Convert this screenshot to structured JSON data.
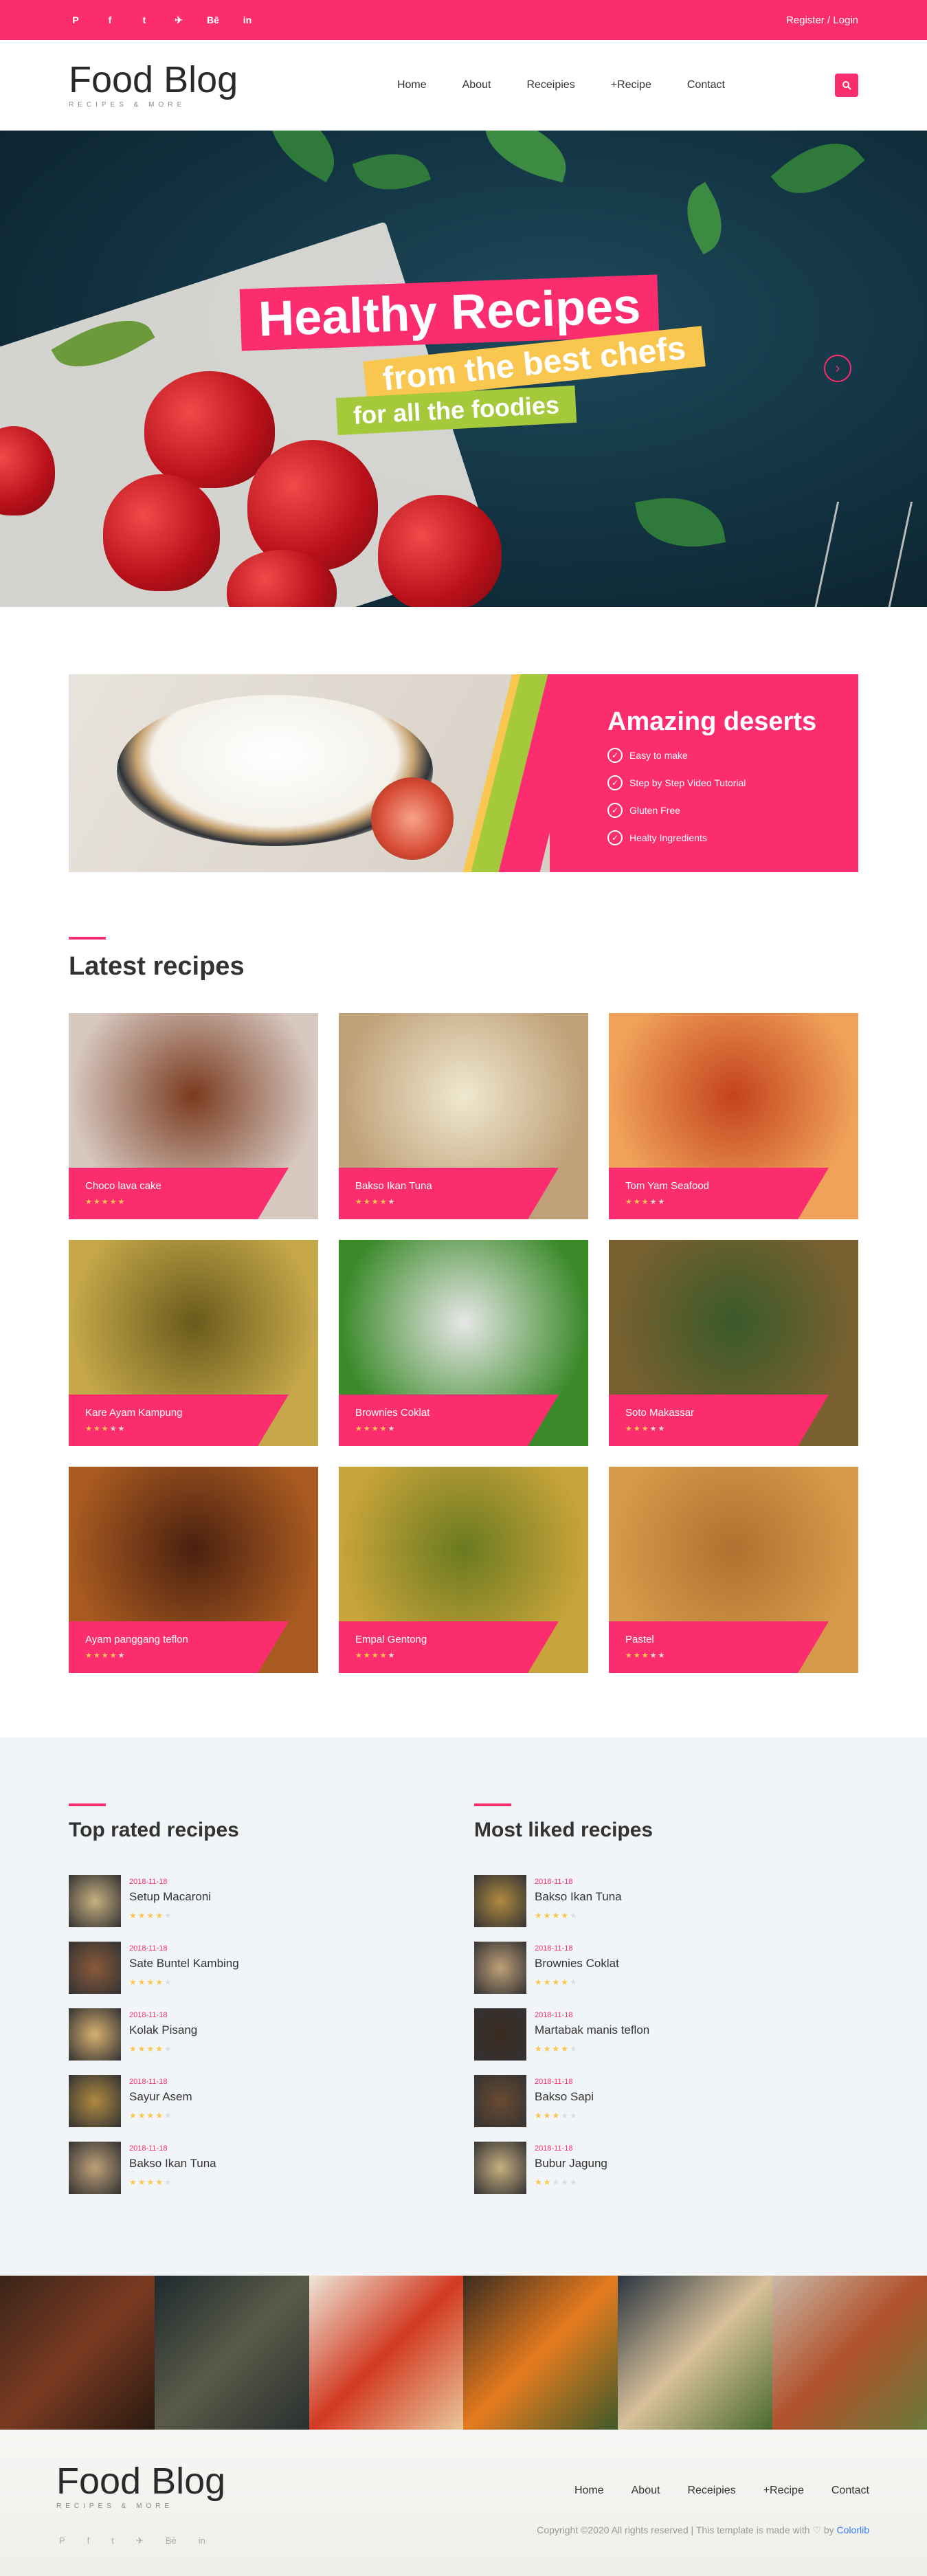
{
  "topbar": {
    "social": [
      "P",
      "f",
      "t",
      "✈",
      "Bē",
      "in"
    ],
    "login": "Register / Login"
  },
  "brand": {
    "name": "Food Blog",
    "tagline": "RECIPES & MORE"
  },
  "nav": [
    "Home",
    "About",
    "Receipies",
    "+Recipe",
    "Contact"
  ],
  "hero": {
    "line1": "Healthy Recipes",
    "line2": "from the best chefs",
    "line3": "for all the foodies"
  },
  "promo": {
    "title": "Amazing deserts",
    "items": [
      "Easy to make",
      "Step by Step Video Tutorial",
      "Gluten Free",
      "Healty Ingredients"
    ]
  },
  "latest": {
    "title": "Latest recipes",
    "items": [
      {
        "title": "Choco lava cake",
        "stars": 5,
        "c1": "#d7c8c0",
        "c2": "#7a3a1f"
      },
      {
        "title": "Bakso Ikan Tuna",
        "stars": 4,
        "c1": "#bfa078",
        "c2": "#efe8cf"
      },
      {
        "title": "Tom Yam Seafood",
        "stars": 3,
        "c1": "#f0a25a",
        "c2": "#c4421d"
      },
      {
        "title": "Kare Ayam Kampung",
        "stars": 3,
        "c1": "#c6a84a",
        "c2": "#6a5a1c"
      },
      {
        "title": "Brownies Coklat",
        "stars": 4,
        "c1": "#3b8a2a",
        "c2": "#e7e7e7"
      },
      {
        "title": "Soto Makassar",
        "stars": 3,
        "c1": "#7a6030",
        "c2": "#3a5a2a"
      },
      {
        "title": "Ayam panggang teflon",
        "stars": 4,
        "c1": "#a85a20",
        "c2": "#4a2010"
      },
      {
        "title": "Empal Gentong",
        "stars": 4,
        "c1": "#c9a43a",
        "c2": "#6a7a20"
      },
      {
        "title": "Pastel",
        "stars": 3,
        "c1": "#d59a4a",
        "c2": "#b07030"
      }
    ]
  },
  "top_rated": {
    "title": "Top rated recipes",
    "items": [
      {
        "date": "2018-11-18",
        "title": "Setup Macaroni",
        "stars": 4
      },
      {
        "date": "2018-11-18",
        "title": "Sate Buntel Kambing",
        "stars": 4
      },
      {
        "date": "2018-11-18",
        "title": "Kolak Pisang",
        "stars": 4
      },
      {
        "date": "2018-11-18",
        "title": "Sayur Asem",
        "stars": 4
      },
      {
        "date": "2018-11-18",
        "title": "Bakso Ikan Tuna",
        "stars": 4
      }
    ]
  },
  "most_liked": {
    "title": "Most liked recipes",
    "items": [
      {
        "date": "2018-11-18",
        "title": "Bakso Ikan Tuna",
        "stars": 4
      },
      {
        "date": "2018-11-18",
        "title": "Brownies Coklat",
        "stars": 4
      },
      {
        "date": "2018-11-18",
        "title": "Martabak manis teflon",
        "stars": 4
      },
      {
        "date": "2018-11-18",
        "title": "Bakso Sapi",
        "stars": 3
      },
      {
        "date": "2018-11-18",
        "title": "Bubur Jagung",
        "stars": 2
      }
    ]
  },
  "footer": {
    "nav": [
      "Home",
      "About",
      "Receipies",
      "+Recipe",
      "Contact"
    ],
    "copyright": "Copyright ©2020 All rights reserved | This template is made with ♡ by",
    "brand": "Colorlib",
    "social": [
      "P",
      "f",
      "t",
      "✈",
      "Bē",
      "in"
    ]
  }
}
